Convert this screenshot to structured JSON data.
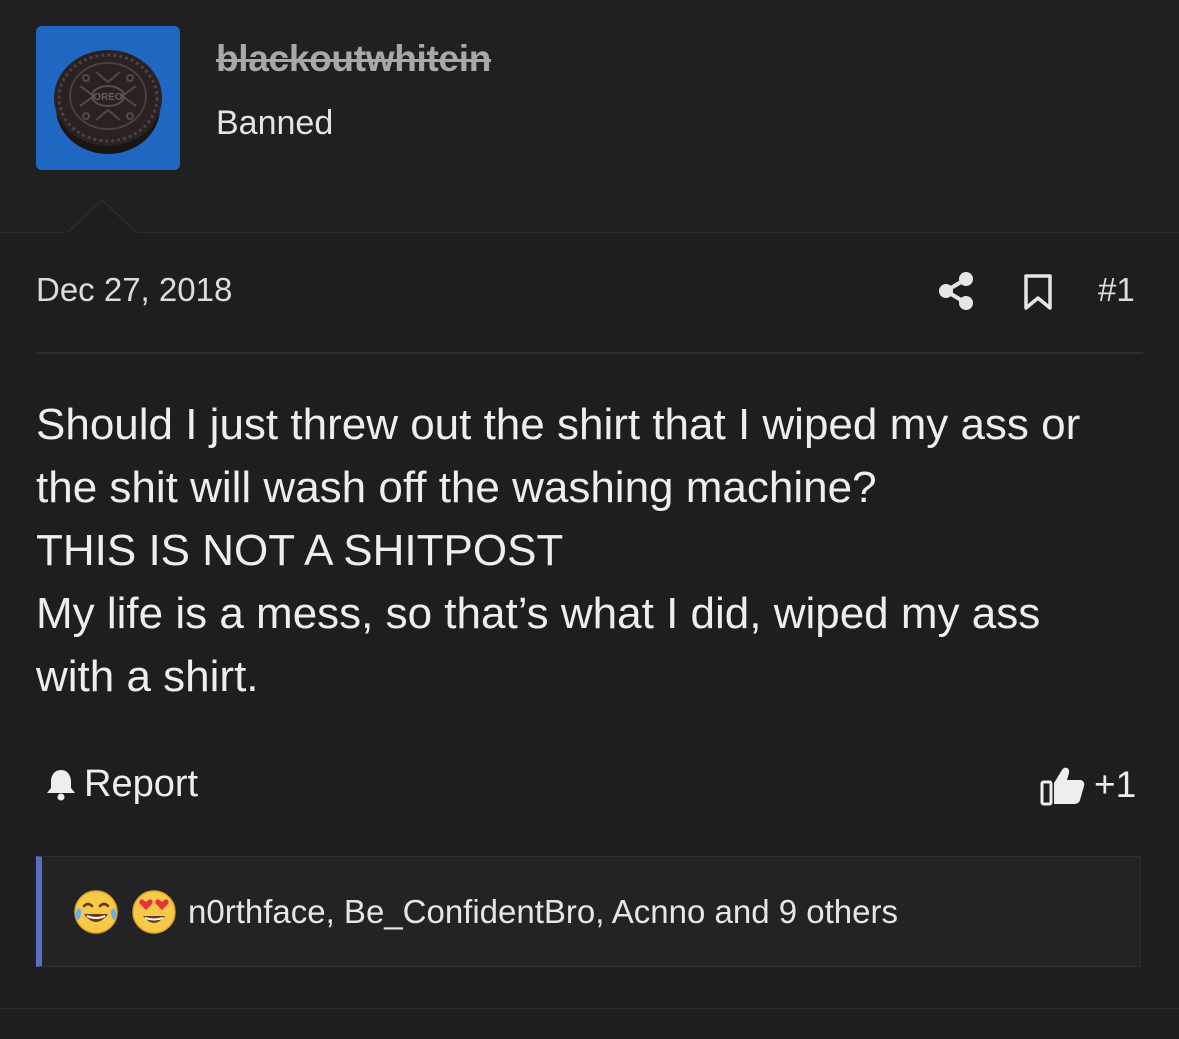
{
  "user": {
    "username": "blackoutwhitein",
    "title": "Banned",
    "avatar": {
      "icon": "oreo-cookie-avatar",
      "background": "#1f67c1",
      "cookie_text": "OREO"
    }
  },
  "post": {
    "date": "Dec 27, 2018",
    "number": "#1",
    "message_lines": [
      "Should I just threw out the shirt that I wiped my ass or",
      "the shit will wash off the washing machine?",
      "THIS IS NOT A SHITPOST",
      "My life is a mess, so that’s what I did, wiped my ass",
      "with a shirt."
    ]
  },
  "actions": {
    "report_label": "Report",
    "like_label": "+1",
    "share_icon": "share-icon",
    "bookmark_icon": "bookmark-icon"
  },
  "reactions": {
    "emojis": [
      "tears-of-joy-emoji",
      "heart-eyes-emoji"
    ],
    "names": "n0rthface, Be_ConfidentBro, Acnno and 9 others"
  },
  "colors": {
    "background": "#1e1e1f",
    "reaction_accent": "#5c6ec4"
  }
}
